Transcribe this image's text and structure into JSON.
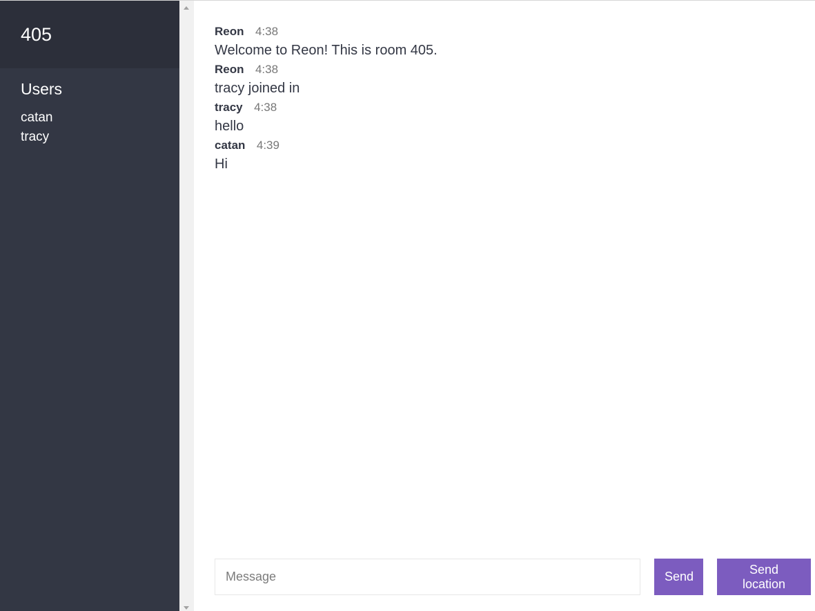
{
  "room": {
    "name": "405"
  },
  "users": {
    "heading": "Users",
    "list": [
      "catan",
      "tracy"
    ]
  },
  "messages": [
    {
      "author": "Reon",
      "time": "4:38",
      "text": "Welcome to Reon! This is room 405."
    },
    {
      "author": "Reon",
      "time": "4:38",
      "text": "tracy joined in"
    },
    {
      "author": "tracy",
      "time": "4:38",
      "text": "hello"
    },
    {
      "author": "catan",
      "time": "4:39",
      "text": "Hi"
    }
  ],
  "composer": {
    "placeholder": "Message",
    "value": "",
    "send_label": "Send",
    "location_label": "Send location"
  },
  "colors": {
    "sidebar": "#333744",
    "sidebar_header": "#2c2f3a",
    "accent": "#7c5cbf"
  }
}
